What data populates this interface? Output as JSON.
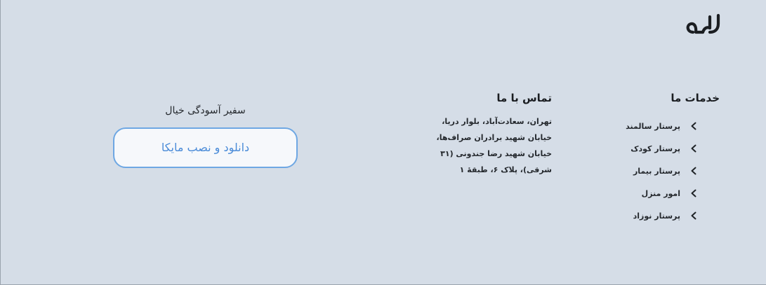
{
  "brand": {
    "logo_text": "مایکا"
  },
  "services": {
    "title": "خدمات ما",
    "items": [
      {
        "label": "پرستار سالمند",
        "icon": "chevron-left-icon"
      },
      {
        "label": "پرستار کودک",
        "icon": "chevron-left-icon"
      },
      {
        "label": "پرستار بیمار",
        "icon": "chevron-left-icon"
      },
      {
        "label": "امور منزل",
        "icon": "chevron-left-icon"
      },
      {
        "label": "پرستار نوزاد",
        "icon": "chevron-left-icon"
      }
    ]
  },
  "contact": {
    "title": "تماس با ما",
    "address_lines": [
      "تهران، سعادت‌آباد، بلوار دریا،",
      "خیابان شهید برادران صراف‌ها،",
      "خیابان شهید رضا جندونی (۳۱",
      "شرقی)، پلاک ۶، طبقهٔ ۱"
    ]
  },
  "app": {
    "slogan": "سفیر آسودگی خیال",
    "download_label": "دانلود و نصب مایکا"
  },
  "colors": {
    "background": "#d5dde7",
    "accent": "#6ea7e3",
    "accent_text": "#4a8bd8"
  }
}
